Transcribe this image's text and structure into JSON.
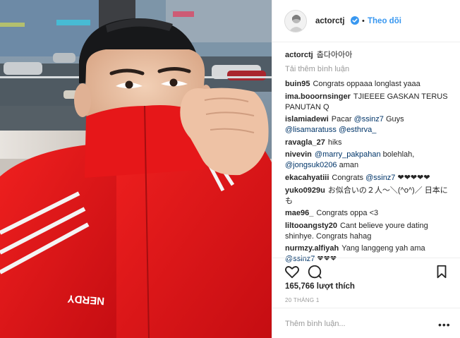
{
  "header": {
    "username": "actorctj",
    "follow_label": "Theo dõi",
    "separator": "•"
  },
  "caption": {
    "username": "actorctj",
    "text": "춥다아아아"
  },
  "load_more": "Tải thêm bình luận",
  "comments": [
    {
      "user": "buin95",
      "parts": [
        {
          "t": "Congrats oppaaa longlast yaaa"
        }
      ]
    },
    {
      "user": "ima.booornsinger",
      "parts": [
        {
          "t": "TJIEEEE GASKAN TERUS PANUTAN Q"
        }
      ]
    },
    {
      "user": "islamiadewi",
      "parts": [
        {
          "t": "Pacar "
        },
        {
          "m": "@ssinz7"
        },
        {
          "t": " Guys "
        },
        {
          "m": "@lisamaratuss"
        },
        {
          "t": " "
        },
        {
          "m": "@esthrva_"
        }
      ]
    },
    {
      "user": "ravagla_27",
      "parts": [
        {
          "t": "hiks"
        }
      ]
    },
    {
      "user": "nivevin",
      "parts": [
        {
          "m": "@marry_pakpahan"
        },
        {
          "t": " bolehlah, "
        },
        {
          "m": "@jongsuk0206"
        },
        {
          "t": " aman"
        }
      ]
    },
    {
      "user": "ekacahyatiii",
      "parts": [
        {
          "t": "Congrats "
        },
        {
          "m": "@ssinz7"
        },
        {
          "t": " ❤❤❤❤❤"
        }
      ]
    },
    {
      "user": "yuko0929u",
      "parts": [
        {
          "t": "お似合いの２人〜＼(^o^)／ 日本にも"
        }
      ]
    },
    {
      "user": "mae96_",
      "parts": [
        {
          "t": "Congrats oppa <3"
        }
      ]
    },
    {
      "user": "liltooangsty20",
      "parts": [
        {
          "t": "Cant believe youre dating shinhye. Congrats hahag"
        }
      ]
    },
    {
      "user": "nurmzy.alfiyah",
      "parts": [
        {
          "t": "Yang langgeng yah ama "
        },
        {
          "m": "@ssinz7"
        },
        {
          "t": " ❤❤❤"
        }
      ]
    }
  ],
  "likes": "165,766 lượt thích",
  "date": "20 THÁNG 1",
  "add_comment_placeholder": "Thêm bình luận...",
  "more_options": "•••",
  "photo": {
    "jacket_text": "NERDY"
  },
  "colors": {
    "link": "#3897f0",
    "mention": "#003569",
    "jacket_red": "#e0141a"
  }
}
